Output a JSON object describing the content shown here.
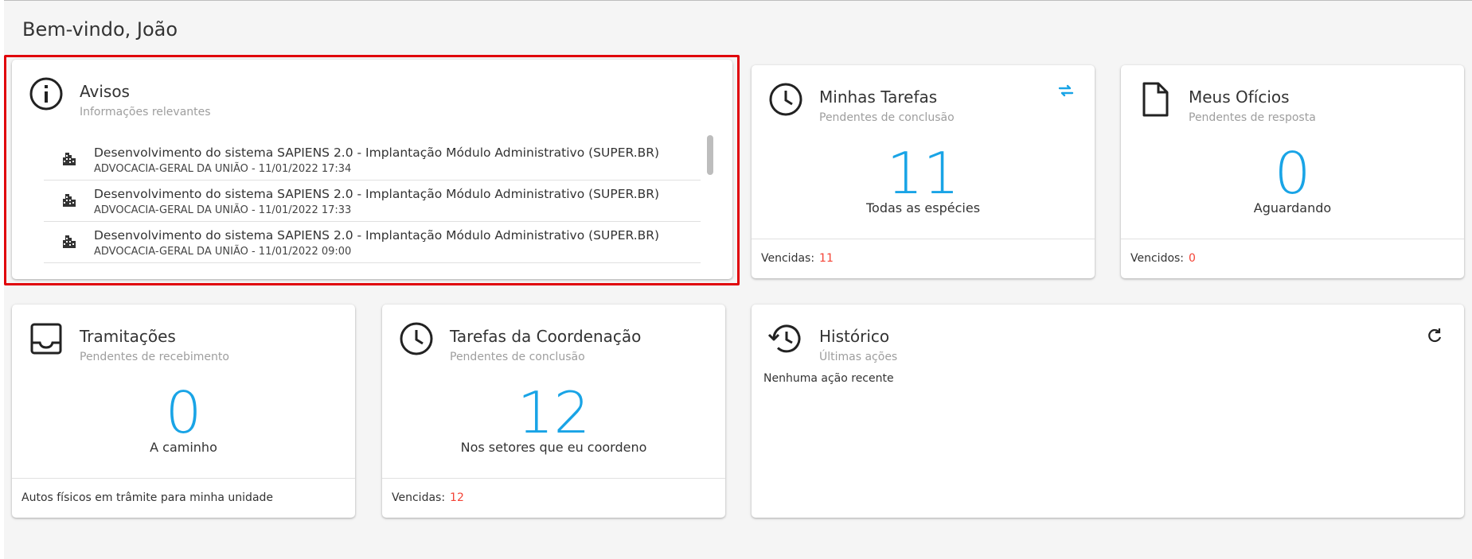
{
  "welcome": "Bem-vindo, João",
  "avisos": {
    "title": "Avisos",
    "subtitle": "Informações relevantes",
    "items": [
      {
        "title": "Desenvolvimento do sistema SAPIENS 2.0 - Implantação Módulo Administrativo (SUPER.BR)",
        "meta": "ADVOCACIA-GERAL DA UNIÃO - 11/01/2022 17:34"
      },
      {
        "title": "Desenvolvimento do sistema SAPIENS 2.0 - Implantação Módulo Administrativo (SUPER.BR)",
        "meta": "ADVOCACIA-GERAL DA UNIÃO - 11/01/2022 17:33"
      },
      {
        "title": "Desenvolvimento do sistema SAPIENS 2.0 - Implantação Módulo Administrativo (SUPER.BR)",
        "meta": "ADVOCACIA-GERAL DA UNIÃO - 11/01/2022 09:00"
      }
    ]
  },
  "minhas_tarefas": {
    "title": "Minhas Tarefas",
    "subtitle": "Pendentes de conclusão",
    "count": "11",
    "caption": "Todas as espécies",
    "footer_label": "Vencidas:",
    "footer_value": "11"
  },
  "meus_oficios": {
    "title": "Meus Ofícios",
    "subtitle": "Pendentes de resposta",
    "count": "0",
    "caption": "Aguardando",
    "footer_label": "Vencidos:",
    "footer_value": "0"
  },
  "tramitacoes": {
    "title": "Tramitações",
    "subtitle": "Pendentes de recebimento",
    "count": "0",
    "caption": "A caminho",
    "footer_label": "Autos físicos em trâmite para minha unidade"
  },
  "tarefas_coordenacao": {
    "title": "Tarefas da Coordenação",
    "subtitle": "Pendentes de conclusão",
    "count": "12",
    "caption": "Nos setores que eu coordeno",
    "footer_label": "Vencidas:",
    "footer_value": "12"
  },
  "historico": {
    "title": "Histórico",
    "subtitle": "Últimas ações",
    "empty": "Nenhuma ação recente"
  },
  "colors": {
    "accent": "#19a4e6",
    "danger": "#f44336",
    "highlight_border": "#e0040b"
  },
  "icons": [
    "info-icon",
    "building-icon",
    "clock-icon",
    "swap-icon",
    "document-icon",
    "inbox-icon",
    "history-icon",
    "refresh-icon"
  ]
}
